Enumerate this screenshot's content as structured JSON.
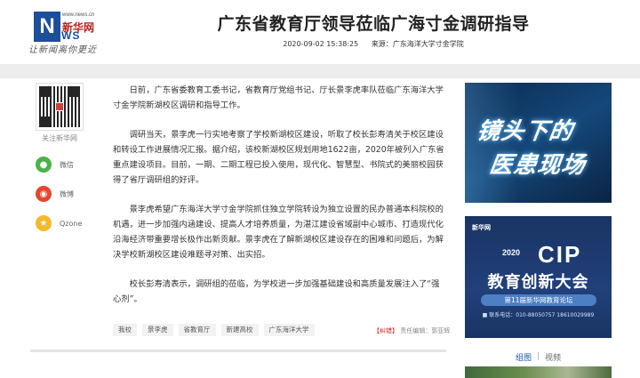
{
  "header": {
    "logo_dotcom": "www.news.cn",
    "logo_cn": "新华网",
    "logo_en": "WS",
    "slogan": "让新闻离你更近",
    "title": "广东省教育厅领导莅临广海寸金调研指导",
    "datetime": "2020-09-02 15:38:25",
    "source": "来源：广东海洋大学寸金学院"
  },
  "share": {
    "qr_label": "关注新华网",
    "items": [
      {
        "label": "微信",
        "icon": "wechat-icon",
        "color": "#4bb34a"
      },
      {
        "label": "微博",
        "icon": "weibo-icon",
        "color": "#e8452f"
      },
      {
        "label": "Qzone",
        "icon": "qzone-icon",
        "color": "#f5b82a"
      }
    ]
  },
  "article": {
    "paragraphs": [
      "日前，广东省委教育工委书记，省教育厅党组书记、厅长景李虎率队莅临广东海洋大学寸金学院新湖校区调研和指导工作。",
      "调研当天，景李虎一行实地考察了学校新湖校区建设，听取了校长彭寿清关于校区建设和转设工作进展情况汇报。据介绍，该校新湖校区规划用地1622亩，2020年被列入广东省重点建设项目。目前，一期、二期工程已投入使用，现代化、智慧型、书院式的美丽校园获得了省厅调研组的好评。",
      "景李虎希望广东海洋大学寸金学院抓住独立学院转设为独立设置的民办普通本科院校的机遇，进一步加强内涵建设、提高人才培养质量，为湛江建设省域副中心城市、打造现代化沿海经济带重要增长极作出新贡献。景李虎在了解新湖校区建设存在的困难和问题后，为解决学校新湖校区建设难题寻对策、出实招。",
      "校长彭寿清表示，调研组的莅临，为学校进一步加强基础建设和高质量发展注入了“强心剂”。"
    ],
    "tags": [
      "我校",
      "景李虎",
      "省教育厅",
      "新建高校",
      "广东海洋大学"
    ],
    "editor_bracket": "【纠错】",
    "editor_label": "责任编辑：郭亚辉"
  },
  "sidebar": {
    "ad1_line1": "镜头下的",
    "ad1_line2": "医患现场",
    "ad2_logo": "新华网",
    "ad2_year": "2020",
    "ad2_cip": "CIP",
    "ad2_title": "教育创新大会",
    "ad2_forum": "第11届新华网教育论坛",
    "ad2_tel": "■ 联系电话：010-88050757  18610029989",
    "tab_photos": "组图",
    "tab_sep": "|",
    "tab_video": "视频"
  }
}
